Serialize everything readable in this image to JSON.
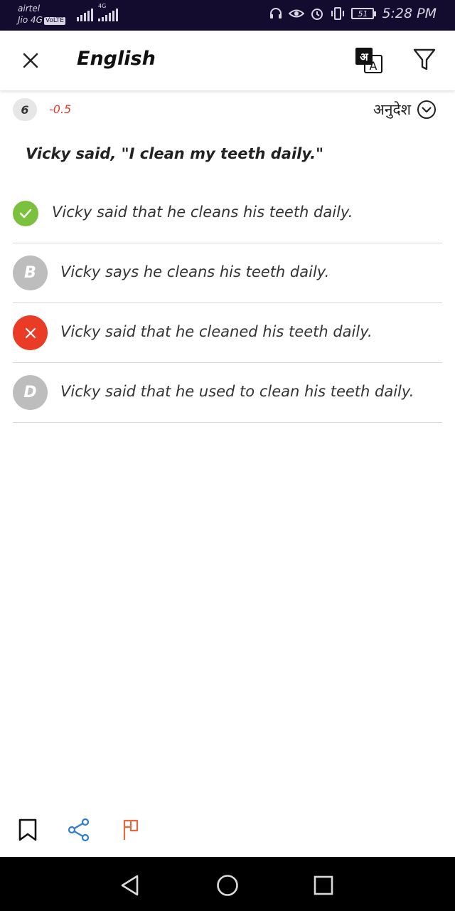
{
  "status_bar": {
    "carrier1": "airtel",
    "carrier2": "Jio 4G",
    "volte": "VoLTE",
    "network_label": "4G",
    "battery": "51",
    "time": "5:28 PM"
  },
  "header": {
    "title": "English"
  },
  "question": {
    "number": "6",
    "negative_marks": "-0.5",
    "instructions_label": "अनुदेश",
    "text": "Vicky said, \"I clean my teeth daily.\""
  },
  "options": [
    {
      "label": "",
      "text": "Vicky said that he cleans his teeth daily.",
      "state": "correct"
    },
    {
      "label": "B",
      "text": "Vicky says he cleans his teeth daily.",
      "state": "neutral"
    },
    {
      "label": "",
      "text": "Vicky said that he cleaned his teeth daily.",
      "state": "wrong"
    },
    {
      "label": "D",
      "text": "Vicky said that he used to clean his teeth daily.",
      "state": "neutral"
    }
  ],
  "colors": {
    "correct": "#7cc13e",
    "wrong": "#ea3b26",
    "neutral": "#bdbdbd",
    "share": "#2f7dd1",
    "flag": "#e5693f"
  },
  "icons": {
    "close": "close-icon",
    "translate": "translate-icon",
    "filter": "filter-icon",
    "bookmark": "bookmark-icon",
    "share": "share-icon",
    "flag": "flag-icon"
  }
}
